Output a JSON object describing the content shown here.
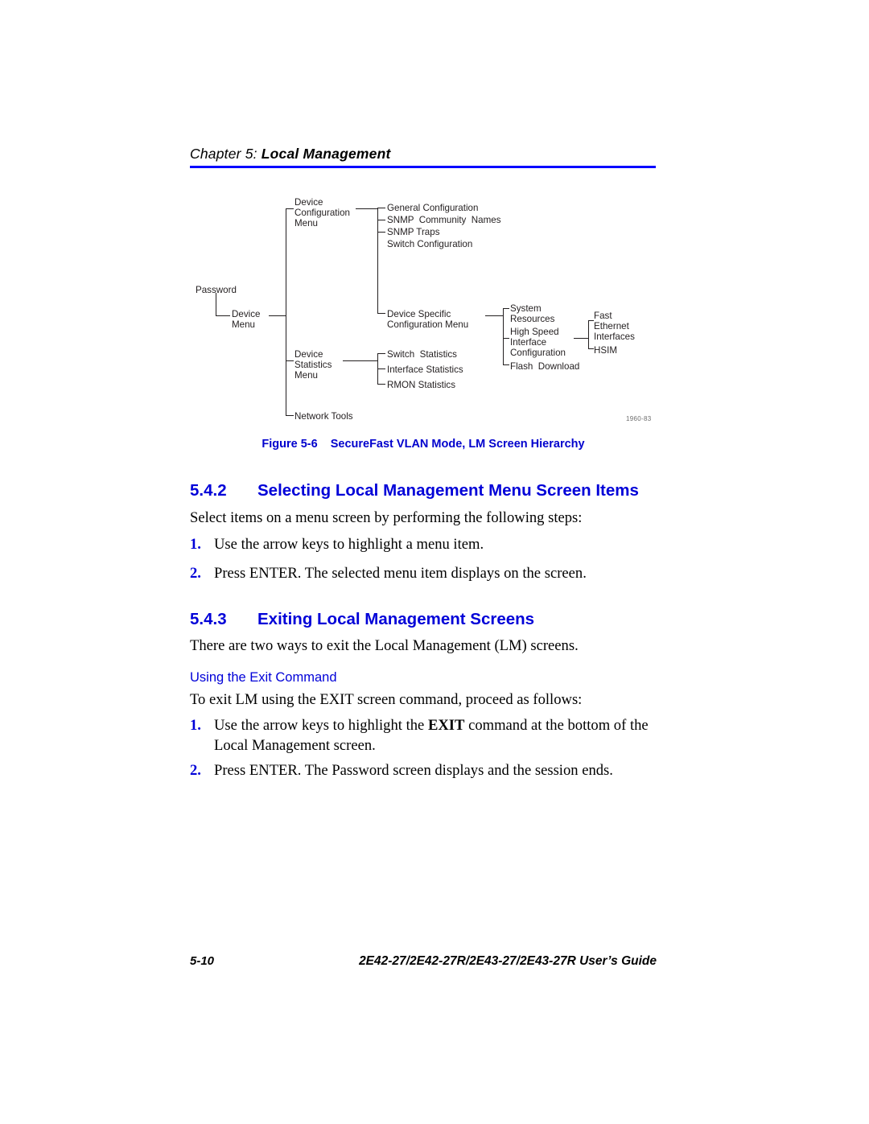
{
  "header": {
    "chapter_label": "Chapter 5:",
    "chapter_title": "Local Management",
    "rule_color": "#0000ff"
  },
  "figure": {
    "id_code": "1960-83",
    "caption_number": "Figure 5-6",
    "caption_title": "SecureFast VLAN Mode, LM Screen Hierarchy",
    "caption_color": "#0000cd",
    "diagram": {
      "type": "tree-hierarchy",
      "nodes": {
        "password": "Password",
        "device_menu": "Device\nMenu",
        "device_config_menu": "Device\nConfiguration\nMenu",
        "general_configuration": "General Configuration",
        "snmp_community_names": "SNMP  Community  Names",
        "snmp_traps": "SNMP Traps",
        "switch_configuration": "Switch Configuration",
        "device_specific_config_menu": "Device Specific\nConfiguration Menu",
        "system_resources": "System\nResources",
        "high_speed_interface_configuration": "High Speed\nInterface\nConfiguration",
        "flash_download": "Flash  Download",
        "fast_ethernet_interfaces": "Fast\nEthernet\nInterfaces",
        "hsim": "HSIM",
        "device_statistics_menu": "Device\nStatistics\nMenu",
        "switch_statistics": "Switch  Statistics",
        "interface_statistics": "Interface Statistics",
        "rmon_statistics": "RMON Statistics",
        "network_tools": "Network Tools"
      }
    }
  },
  "sections": [
    {
      "number": "5.4.2",
      "title": "Selecting Local Management Menu Screen Items",
      "intro": "Select items on a menu screen by performing the following steps:",
      "steps": [
        {
          "num": "1.",
          "text": "Use the arrow keys to highlight a menu item."
        },
        {
          "num": "2.",
          "text": "Press ENTER. The selected menu item displays on the screen."
        }
      ]
    },
    {
      "number": "5.4.3",
      "title": "Exiting Local Management Screens",
      "intro": "There are two ways to exit the Local Management (LM) screens.",
      "subheading": "Using the Exit Command",
      "sub_intro": "To exit LM using the EXIT screen command, proceed as follows:",
      "steps": [
        {
          "num": "1.",
          "text_before": "Use the arrow keys to highlight the ",
          "text_bold": "EXIT",
          "text_after": " command at the bottom of the Local Management screen."
        },
        {
          "num": "2.",
          "text": "Press ENTER. The Password screen displays and the session ends."
        }
      ]
    }
  ],
  "footer": {
    "page_number": "5-10",
    "document_title": "2E42-27/2E42-27R/2E43-27/2E43-27R User’s Guide"
  }
}
